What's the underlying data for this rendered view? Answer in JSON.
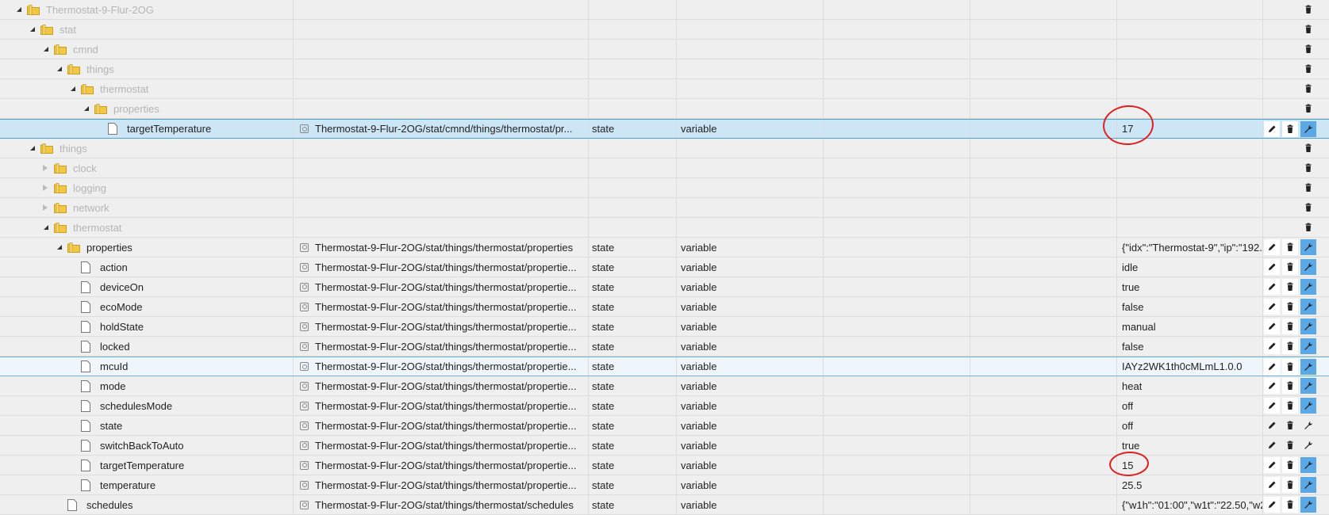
{
  "rows": [
    {
      "name": "Thermostat-9-Flur-2OG",
      "level": 0,
      "kind": "folder",
      "toggle": "open",
      "grey": true,
      "id": "",
      "role": "",
      "type": "",
      "value": "",
      "actions": "del"
    },
    {
      "name": "stat",
      "level": 1,
      "kind": "folder",
      "toggle": "open",
      "grey": true,
      "id": "",
      "role": "",
      "type": "",
      "value": "",
      "actions": "del"
    },
    {
      "name": "cmnd",
      "level": 2,
      "kind": "folder",
      "toggle": "open",
      "grey": true,
      "id": "",
      "role": "",
      "type": "",
      "value": "",
      "actions": "del"
    },
    {
      "name": "things",
      "level": 3,
      "kind": "folder",
      "toggle": "open",
      "grey": true,
      "id": "",
      "role": "",
      "type": "",
      "value": "",
      "actions": "del"
    },
    {
      "name": "thermostat",
      "level": 4,
      "kind": "folder",
      "toggle": "open",
      "grey": true,
      "id": "",
      "role": "",
      "type": "",
      "value": "",
      "actions": "del"
    },
    {
      "name": "properties",
      "level": 5,
      "kind": "folder",
      "toggle": "open",
      "grey": true,
      "id": "",
      "role": "",
      "type": "",
      "value": "",
      "actions": "del"
    },
    {
      "name": "targetTemperature",
      "level": 6,
      "kind": "file",
      "grey": false,
      "selected": true,
      "id": "Thermostat-9-Flur-2OG/stat/cmnd/things/thermostat/pr...",
      "role": "state",
      "type": "variable",
      "value": "17",
      "actions": "full"
    },
    {
      "name": "things",
      "level": 1,
      "kind": "folder",
      "toggle": "open",
      "grey": true,
      "id": "",
      "role": "",
      "type": "",
      "value": "",
      "actions": "del"
    },
    {
      "name": "clock",
      "level": 2,
      "kind": "folder",
      "toggle": "closed",
      "grey": true,
      "id": "",
      "role": "",
      "type": "",
      "value": "",
      "actions": "del"
    },
    {
      "name": "logging",
      "level": 2,
      "kind": "folder",
      "toggle": "closed",
      "grey": true,
      "id": "",
      "role": "",
      "type": "",
      "value": "",
      "actions": "del"
    },
    {
      "name": "network",
      "level": 2,
      "kind": "folder",
      "toggle": "closed",
      "grey": true,
      "id": "",
      "role": "",
      "type": "",
      "value": "",
      "actions": "del"
    },
    {
      "name": "thermostat",
      "level": 2,
      "kind": "folder",
      "toggle": "open",
      "grey": true,
      "id": "",
      "role": "",
      "type": "",
      "value": "",
      "actions": "del"
    },
    {
      "name": "properties",
      "level": 3,
      "kind": "folder",
      "toggle": "open",
      "grey": false,
      "id": "Thermostat-9-Flur-2OG/stat/things/thermostat/properties",
      "role": "state",
      "type": "variable",
      "value": "{\"idx\":\"Thermostat-9\",\"ip\":\"192.",
      "actions": "full"
    },
    {
      "name": "action",
      "level": 4,
      "kind": "file",
      "grey": false,
      "id": "Thermostat-9-Flur-2OG/stat/things/thermostat/propertie...",
      "role": "state",
      "type": "variable",
      "value": "idle",
      "actions": "full"
    },
    {
      "name": "deviceOn",
      "level": 4,
      "kind": "file",
      "grey": false,
      "id": "Thermostat-9-Flur-2OG/stat/things/thermostat/propertie...",
      "role": "state",
      "type": "variable",
      "value": "true",
      "actions": "full"
    },
    {
      "name": "ecoMode",
      "level": 4,
      "kind": "file",
      "grey": false,
      "id": "Thermostat-9-Flur-2OG/stat/things/thermostat/propertie...",
      "role": "state",
      "type": "variable",
      "value": "false",
      "actions": "full"
    },
    {
      "name": "holdState",
      "level": 4,
      "kind": "file",
      "grey": false,
      "id": "Thermostat-9-Flur-2OG/stat/things/thermostat/propertie...",
      "role": "state",
      "type": "variable",
      "value": "manual",
      "actions": "full"
    },
    {
      "name": "locked",
      "level": 4,
      "kind": "file",
      "grey": false,
      "id": "Thermostat-9-Flur-2OG/stat/things/thermostat/propertie...",
      "role": "state",
      "type": "variable",
      "value": "false",
      "actions": "full"
    },
    {
      "name": "mcuId",
      "level": 4,
      "kind": "file",
      "grey": false,
      "highlight": true,
      "id": "Thermostat-9-Flur-2OG/stat/things/thermostat/propertie...",
      "role": "state",
      "type": "variable",
      "value": "IAYz2WK1th0cMLmL1.0.0",
      "actions": "full"
    },
    {
      "name": "mode",
      "level": 4,
      "kind": "file",
      "grey": false,
      "id": "Thermostat-9-Flur-2OG/stat/things/thermostat/propertie...",
      "role": "state",
      "type": "variable",
      "value": "heat",
      "actions": "full"
    },
    {
      "name": "schedulesMode",
      "level": 4,
      "kind": "file",
      "grey": false,
      "id": "Thermostat-9-Flur-2OG/stat/things/thermostat/propertie...",
      "role": "state",
      "type": "variable",
      "value": "off",
      "actions": "full"
    },
    {
      "name": "state",
      "level": 4,
      "kind": "file",
      "grey": false,
      "id": "Thermostat-9-Flur-2OG/stat/things/thermostat/propertie...",
      "role": "state",
      "type": "variable",
      "value": "off",
      "actions": "flat"
    },
    {
      "name": "switchBackToAuto",
      "level": 4,
      "kind": "file",
      "grey": false,
      "id": "Thermostat-9-Flur-2OG/stat/things/thermostat/propertie...",
      "role": "state",
      "type": "variable",
      "value": "true",
      "actions": "flat"
    },
    {
      "name": "targetTemperature",
      "level": 4,
      "kind": "file",
      "grey": false,
      "id": "Thermostat-9-Flur-2OG/stat/things/thermostat/propertie...",
      "role": "state",
      "type": "variable",
      "value": "15",
      "actions": "full"
    },
    {
      "name": "temperature",
      "level": 4,
      "kind": "file",
      "grey": false,
      "id": "Thermostat-9-Flur-2OG/stat/things/thermostat/propertie...",
      "role": "state",
      "type": "variable",
      "value": "25.5",
      "actions": "full"
    },
    {
      "name": "schedules",
      "level": 3,
      "kind": "file",
      "grey": false,
      "id": "Thermostat-9-Flur-2OG/stat/things/thermostat/schedules",
      "role": "state",
      "type": "variable",
      "value": "{\"w1h\":\"01:00\",\"w1t\":\"22.50,\"w2h",
      "actions": "full"
    }
  ]
}
